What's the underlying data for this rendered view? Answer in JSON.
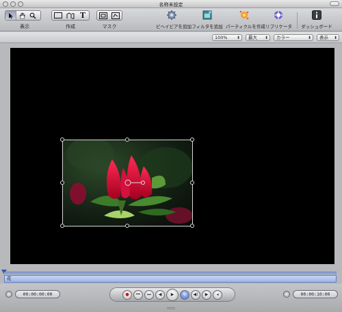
{
  "window": {
    "title": "名称未設定"
  },
  "toolbar": {
    "groups": [
      {
        "label": "表示"
      },
      {
        "label": "作成"
      },
      {
        "label": "マスク"
      }
    ],
    "actions": [
      {
        "label": "ビヘイビアを追加",
        "icon": "gear-icon"
      },
      {
        "label": "フィルタを追加",
        "icon": "filter-icon"
      },
      {
        "label": "パーティクルを作成",
        "icon": "particle-icon"
      },
      {
        "label": "リプリケータ",
        "icon": "replicator-icon"
      },
      {
        "label": "ダッシュボード",
        "icon": "info-icon"
      }
    ],
    "text_tool_glyph": "T"
  },
  "view_options": {
    "zoom": "100%",
    "resolution": "最大",
    "channels": "カラー",
    "display": "表示"
  },
  "timeline": {
    "track_label": "花"
  },
  "transport": {
    "current_time": "00:00:00:00",
    "duration": "00:00:10:00"
  }
}
